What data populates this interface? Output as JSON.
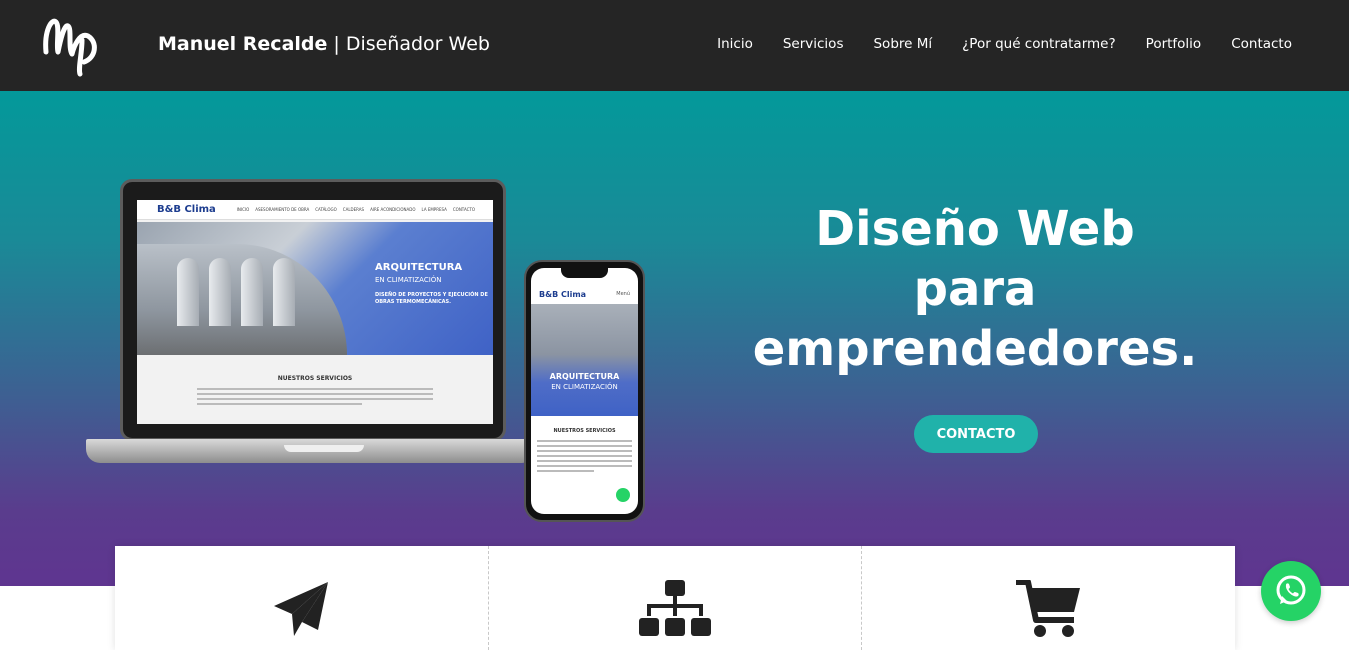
{
  "header": {
    "brand_name": "Manuel Recalde",
    "brand_separator": "|",
    "brand_role": "Diseñador Web",
    "nav": [
      "Inicio",
      "Servicios",
      "Sobre Mí",
      "¿Por qué contratarme?",
      "Portfolio",
      "Contacto"
    ]
  },
  "hero": {
    "title_line1": "Diseño Web",
    "title_line2": "para",
    "title_line3": "emprendedores.",
    "cta_label": "CONTACTO"
  },
  "mockup": {
    "logo": "B&B Clima",
    "nav": [
      "INICIO",
      "ASESORAMIENTO DE OBRA",
      "CATÁLOGO",
      "CALDERAS",
      "AIRE ACONDICIONADO",
      "LA EMPRESA",
      "CONTACTO"
    ],
    "hero_title": "ARQUITECTURA",
    "hero_sub": "EN CLIMATIZACIÓN",
    "hero_small": "DISEÑO DE PROYECTOS Y EJECUCIÓN DE OBRAS TERMOMECÁNICAS.",
    "section_title": "NUESTROS SERVICIOS",
    "phone_menu": "Menú"
  },
  "services": [
    {
      "icon": "paper-plane-icon"
    },
    {
      "icon": "sitemap-icon"
    },
    {
      "icon": "shopping-cart-icon"
    }
  ],
  "colors": {
    "header_bg": "#252525",
    "hero_top": "#03999a",
    "hero_bottom": "#5f3590",
    "cta_bg": "#20b2aa",
    "whatsapp": "#25d366"
  }
}
